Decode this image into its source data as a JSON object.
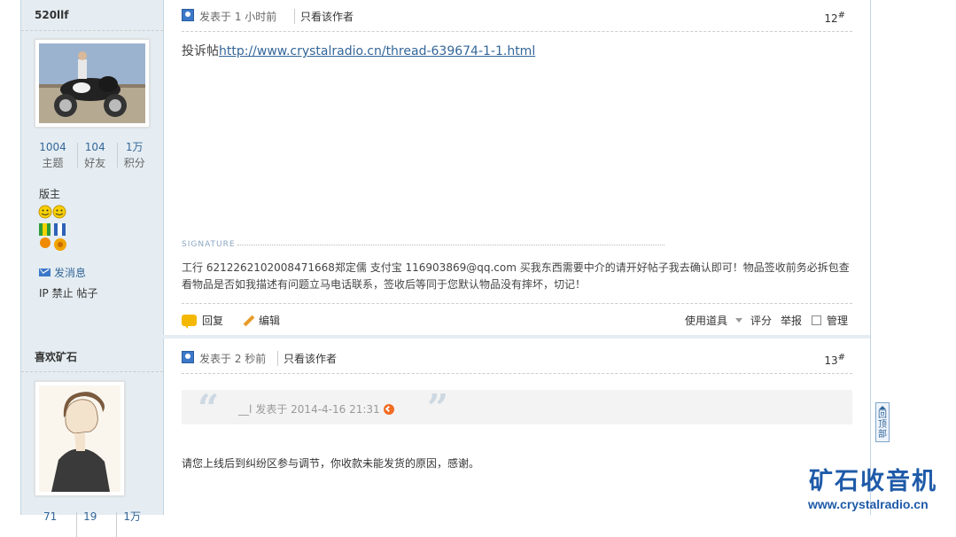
{
  "posts": [
    {
      "author": {
        "name": "520llf",
        "stats": [
          {
            "value": "1004",
            "label": "主题"
          },
          {
            "value": "104",
            "label": "好友"
          },
          {
            "value": "1万",
            "label": "积分"
          }
        ],
        "role": "版主",
        "send_message": "发消息",
        "mod_links": [
          "IP",
          "禁止",
          "帖子"
        ]
      },
      "time": "发表于 1 小时前",
      "only_author": "只看该作者",
      "floor": "12",
      "floor_mark": "#",
      "body_prefix": "投诉帖",
      "body_link": "http://www.crystalradio.cn/thread-639674-1-1.html",
      "signature_label": "SIGNATURE",
      "signature": "工行 6212262102008471668郑定儒  支付宝 116903869@qq.com 买我东西需要中介的请开好帖子我去确认即可！物品签收前务必拆包查看物品是否如我描述有问题立马电话联系，签收后等同于您默认物品没有摔坏，切记！",
      "actions": {
        "reply": "回复",
        "edit": "编辑",
        "tools": "使用道具",
        "rate": "评分",
        "report": "举报",
        "manage": "管理"
      }
    },
    {
      "author": {
        "name": "喜欢矿石",
        "stats": [
          {
            "value": "71",
            "label": ""
          },
          {
            "value": "19",
            "label": ""
          },
          {
            "value": "1万",
            "label": ""
          }
        ]
      },
      "time": "发表于 2 秒前",
      "only_author": "只看该作者",
      "floor": "13",
      "floor_mark": "#",
      "quote_author": "__l",
      "quote_time": "发表于 2014-4-16 21:31",
      "reply": "请您上线后到纠纷区参与调节，你收款未能发货的原因，感谢。"
    }
  ],
  "back_to_top": "回顶部",
  "watermark": {
    "title": "矿石收音机",
    "url": "www.crystalradio.cn"
  },
  "colors": {
    "sidebar": "#e5edf2",
    "link": "#336699",
    "watermark": "#1e5aa8"
  }
}
